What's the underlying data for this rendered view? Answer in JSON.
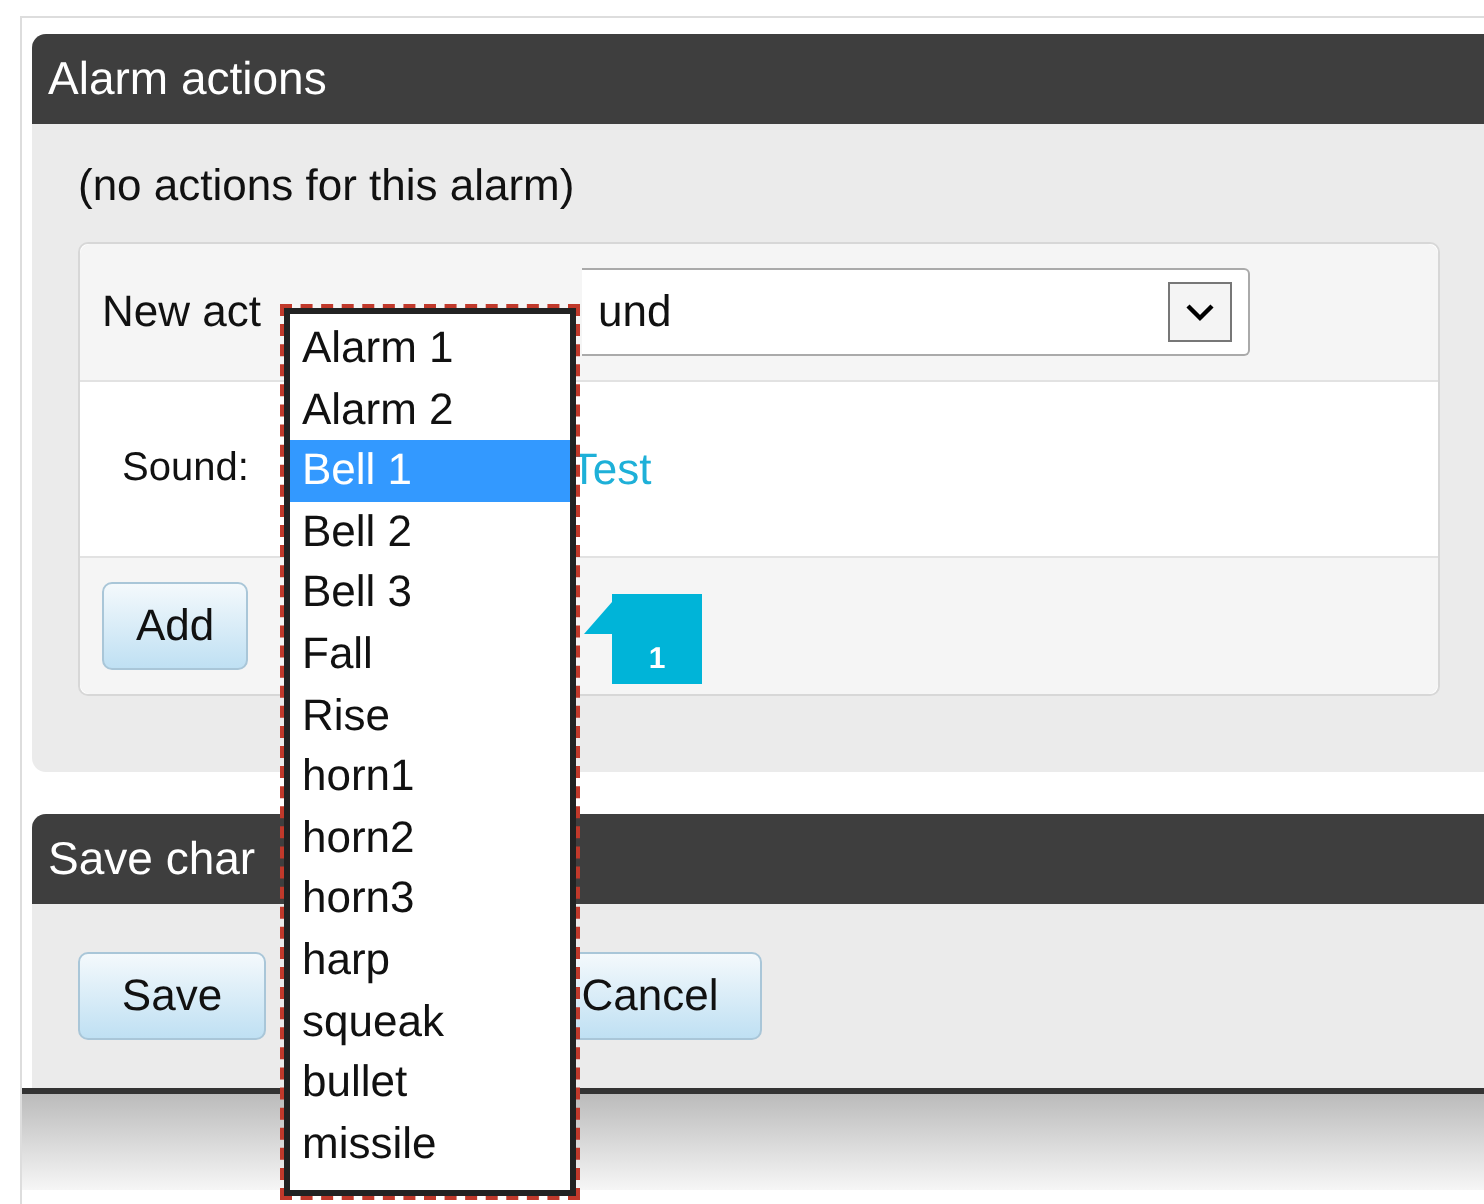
{
  "alarm_actions": {
    "title": "Alarm actions",
    "empty_message": "(no actions for this alarm)",
    "new_action_label": "New act",
    "new_action_value": "und",
    "sound_label": "Sound:",
    "test_link": "Test",
    "add_button": "Add"
  },
  "save_changes": {
    "title": "Save char",
    "buttons": [
      {
        "kind": "save",
        "label": "Save"
      },
      {
        "kind": "cancel",
        "label": "Cancel"
      }
    ]
  },
  "sound_dropdown": {
    "options": [
      {
        "label": "Alarm 1",
        "selected": false
      },
      {
        "label": "Alarm 2",
        "selected": false
      },
      {
        "label": "Bell 1",
        "selected": true
      },
      {
        "label": "Bell 2",
        "selected": false
      },
      {
        "label": "Bell 3",
        "selected": false
      },
      {
        "label": "Fall",
        "selected": false
      },
      {
        "label": "Rise",
        "selected": false
      },
      {
        "label": "horn1",
        "selected": false
      },
      {
        "label": "horn2",
        "selected": false
      },
      {
        "label": "horn3",
        "selected": false
      },
      {
        "label": "harp",
        "selected": false
      },
      {
        "label": "squeak",
        "selected": false
      },
      {
        "label": "bullet",
        "selected": false
      },
      {
        "label": "missile",
        "selected": false
      }
    ]
  },
  "callout": {
    "label": "1"
  }
}
